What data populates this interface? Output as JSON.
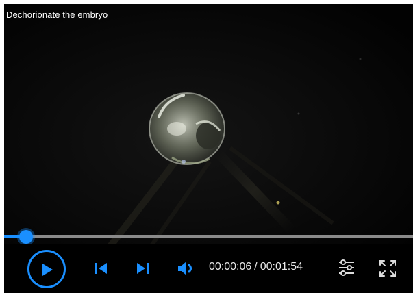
{
  "video": {
    "title": "Dechorionate the embryo"
  },
  "playback": {
    "current_time": "00:00:06",
    "separator": "/",
    "duration": "00:01:54",
    "progress_fraction": 0.053
  },
  "controls": {
    "play_icon": "play-icon",
    "previous_icon": "skip-previous-icon",
    "next_icon": "skip-next-icon",
    "volume_icon": "volume-icon",
    "settings_icon": "settings-sliders-icon",
    "fullscreen_icon": "fullscreen-icon"
  },
  "colors": {
    "accent": "#1a8fff",
    "track": "#8a8a8a",
    "background": "#000000",
    "text": "#e9e9e9"
  }
}
